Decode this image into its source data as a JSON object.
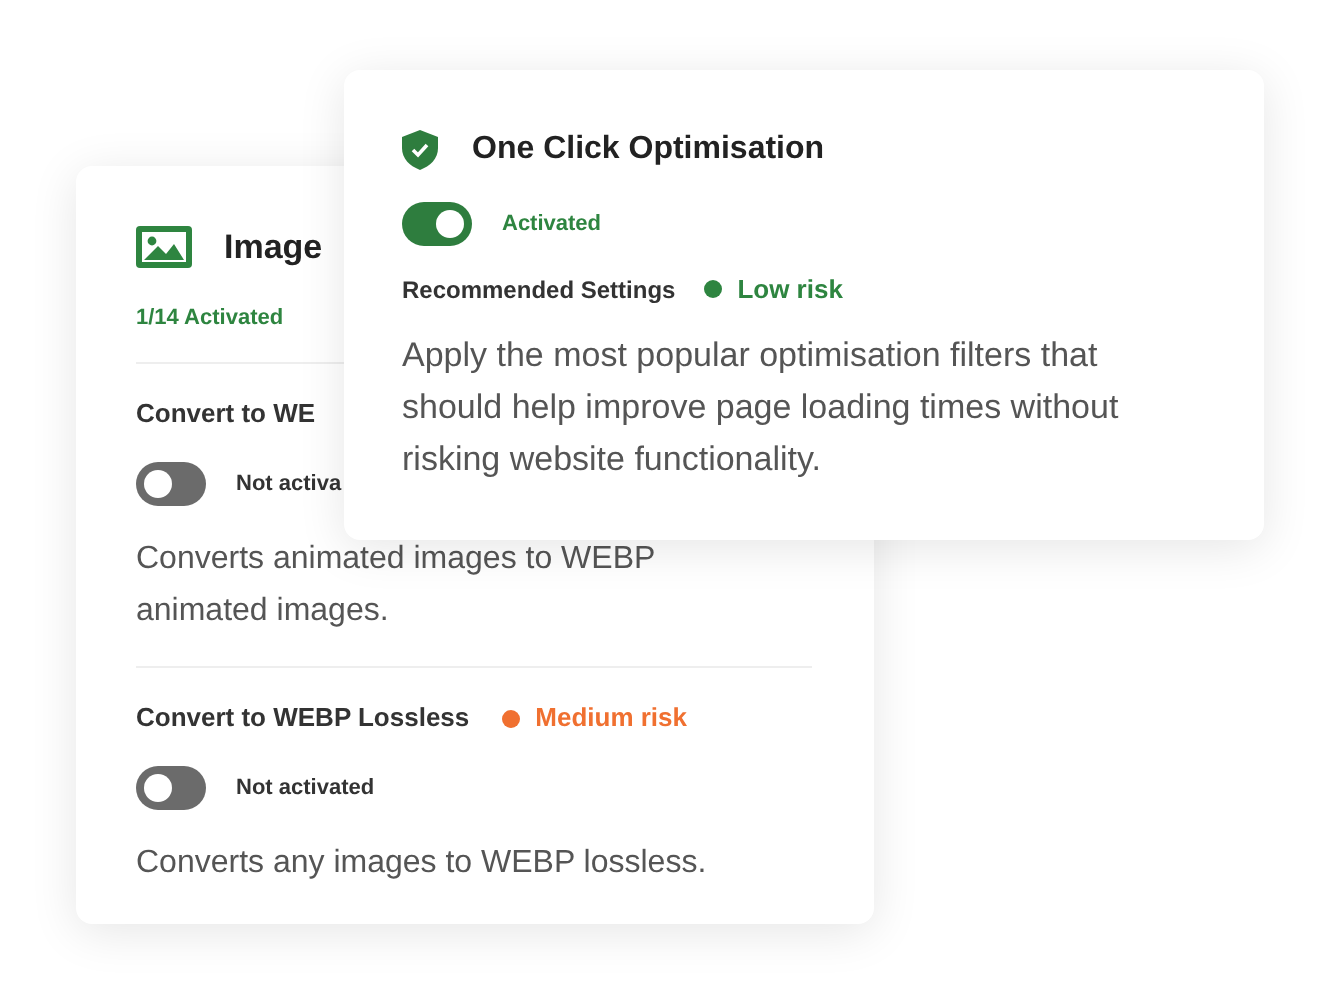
{
  "back_card": {
    "title": "Image",
    "summary": "1/14 Activated",
    "settings": [
      {
        "label": "Convert to WE",
        "toggle": {
          "on": false
        },
        "status": "Not activa",
        "description": "Converts animated images to WEBP animated images."
      },
      {
        "label": "Convert to WEBP Lossless",
        "risk": {
          "label": "Medium risk",
          "color": "#f07030"
        },
        "toggle": {
          "on": false
        },
        "status": "Not activated",
        "description": "Converts any images to WEBP lossless."
      }
    ]
  },
  "front_card": {
    "title": "One Click Optimisation",
    "toggle": {
      "on": true
    },
    "status": "Activated",
    "recommended_label": "Recommended Settings",
    "risk": {
      "label": "Low risk",
      "color": "#2e8540"
    },
    "description": "Apply the most popular optimisation filters that should help improve page loading times without risking website functionality."
  }
}
